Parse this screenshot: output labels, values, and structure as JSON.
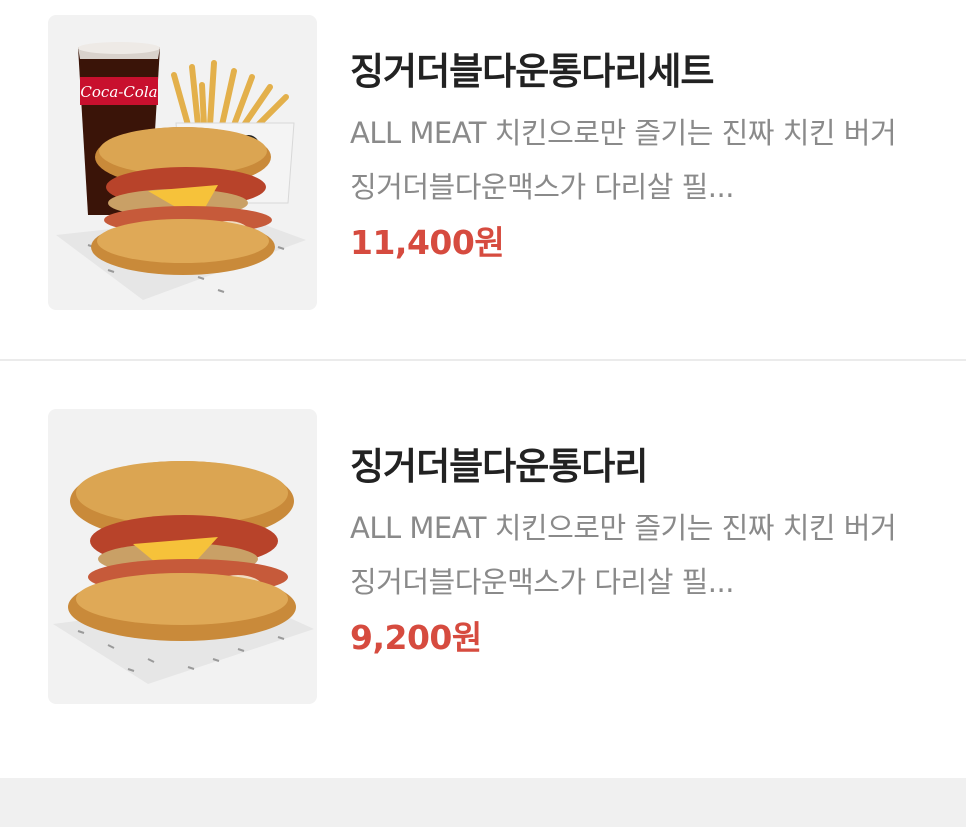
{
  "menu": {
    "items": [
      {
        "name": "징거더블다운통다리세트",
        "description": "ALL MEAT 치킨으로만 즐기는 진짜 치킨 버거 징거더블다운맥스가 다리살 필...",
        "price": "11,400원",
        "image": "burger-set-with-cola-and-fries-image"
      },
      {
        "name": "징거더블다운통다리",
        "description": "ALL MEAT 치킨으로만 즐기는 진짜 치킨 버거 징거더블다운맥스가 다리살 필...",
        "price": "9,200원",
        "image": "burger-image"
      }
    ],
    "colors": {
      "price": "#d64b3f",
      "title": "#222222",
      "description": "#8a8a8a",
      "thumb_bg": "#f2f2f2"
    }
  }
}
